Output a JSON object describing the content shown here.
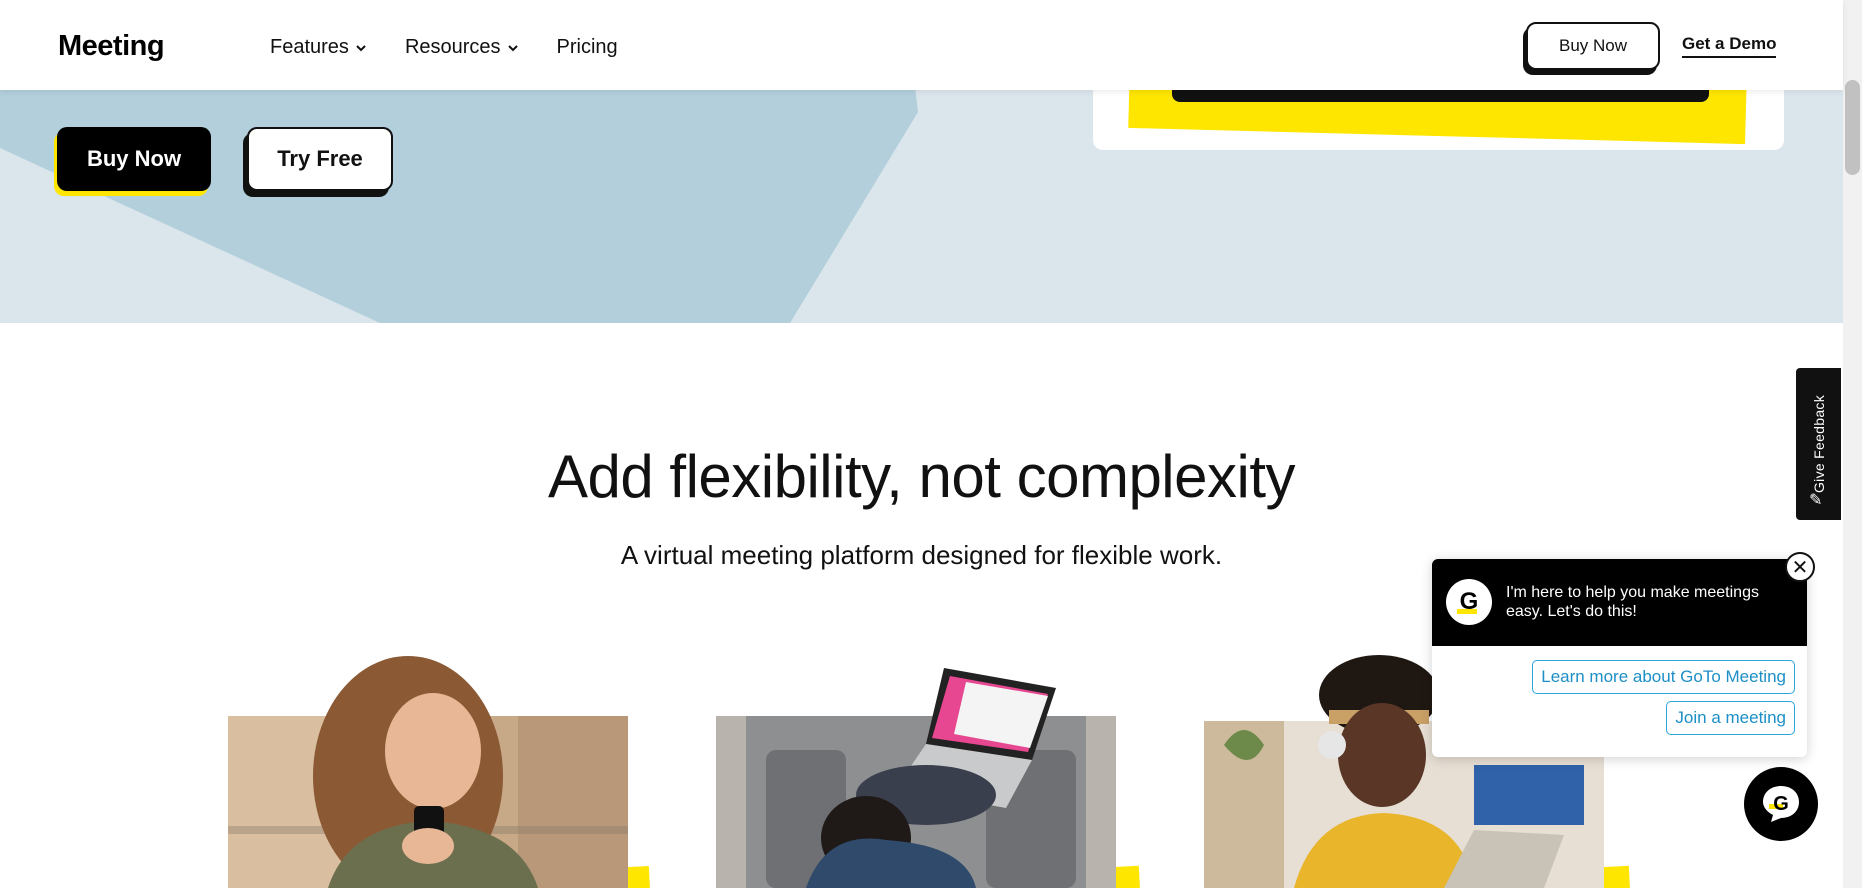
{
  "header": {
    "logo": "Meeting",
    "nav": [
      {
        "label": "Features",
        "has_dropdown": true
      },
      {
        "label": "Resources",
        "has_dropdown": true
      },
      {
        "label": "Pricing",
        "has_dropdown": false
      }
    ],
    "buy_now": "Buy Now",
    "get_demo": "Get a Demo"
  },
  "hero": {
    "buy_now": "Buy Now",
    "try_free": "Try Free"
  },
  "section": {
    "title": "Add flexibility, not complexity",
    "subtitle": "A virtual meeting platform designed for flexible work."
  },
  "feedback": {
    "label": "Give Feedback"
  },
  "chat": {
    "avatar_letter": "G",
    "message": "I'm here to help you make meetings easy. Let's do this!",
    "options": [
      "Learn more about GoTo Meeting",
      "Join a meeting"
    ],
    "close_symbol": "✕",
    "launcher_letter": "G"
  },
  "colors": {
    "brand_yellow": "#ffe600",
    "hero_bg": "#dbe6ec",
    "hero_shape": "#b2cfdb",
    "chat_link": "#1d8fc6"
  }
}
